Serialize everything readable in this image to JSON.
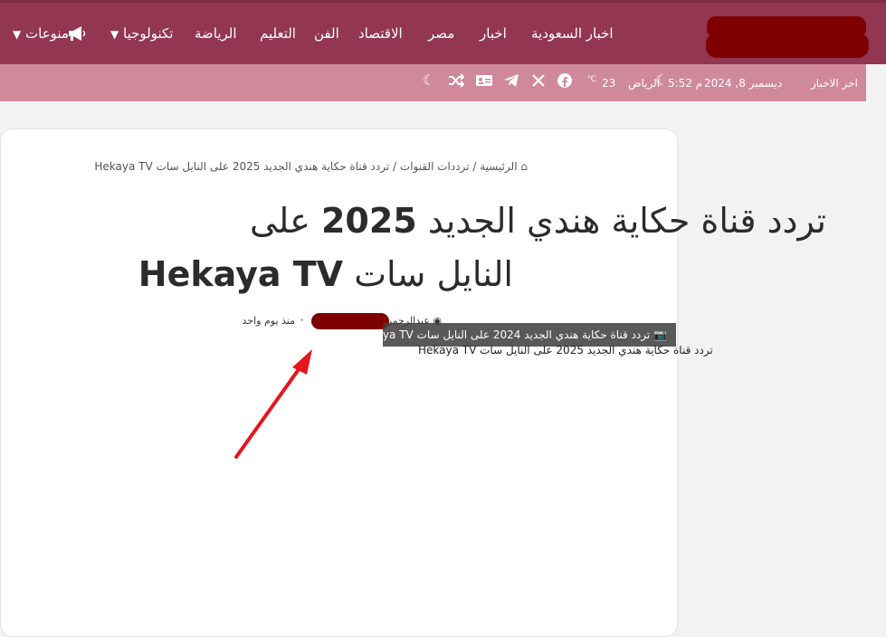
{
  "header": {
    "logo_text": "",
    "nav": [
      {
        "label": "اخبار السعودية"
      },
      {
        "label": "اخبار"
      },
      {
        "label": "مصر"
      },
      {
        "label": "الاقتصاد"
      },
      {
        "label": "الفن"
      },
      {
        "label": "التعليم"
      },
      {
        "label": "الرياضة"
      },
      {
        "label": "تكنولوجيا"
      },
      {
        "label": "منوعات"
      }
    ]
  },
  "subbar": {
    "latest_label": "اخر الاخبار",
    "date": "ديسمبر 8, 2024",
    "time": "5:52 م",
    "weather_city": "الرياض",
    "weather_temp": "23",
    "weather_unit": "℃"
  },
  "article": {
    "breadcrumb": {
      "home": "الرئيسية",
      "sep1": "/",
      "category": "ترددات القنوات",
      "sep2": "/",
      "current": "تردد قناة حكاية هندي الجديد 2025 على النايل سات Hekaya TV"
    },
    "title_line1_prefix": "تردد قناة حكاية هندي الجديد",
    "title_year": "2025",
    "title_line1_suffix": "على",
    "title_line2_prefix": "النايل سات",
    "title_line2_brand": "Hekaya TV",
    "author": "عبدالرحمن",
    "published": "منذ يوم واحد",
    "image_tooltip": "تردد قناة حكاية هندي الجديد 2024 على النايل سات Hekaya TV",
    "image_caption": "تردد قناة حكاية هندي الجديد 2025 على النايل سات Hekaya TV"
  },
  "colors": {
    "topbar": "#933651",
    "subbar": "#d0889b",
    "redaction": "#7e0000",
    "arrow": "#e8141d"
  }
}
